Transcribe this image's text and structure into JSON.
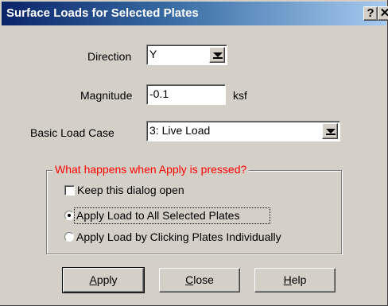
{
  "window": {
    "title": "Surface Loads for Selected Plates",
    "help_glyph": "?",
    "close_glyph": "✕"
  },
  "form": {
    "direction_label": "Direction",
    "direction_value": "Y",
    "magnitude_label": "Magnitude",
    "magnitude_value": "-0.1",
    "magnitude_unit": "ksf",
    "load_case_label": "Basic Load Case",
    "load_case_value": "3: Live Load"
  },
  "group": {
    "title": "What happens when Apply is pressed?",
    "keep_open_label": "Keep this dialog open",
    "keep_open_checked": false,
    "options": [
      {
        "label": "Apply Load to All Selected Plates",
        "selected": true
      },
      {
        "label": "Apply Load by Clicking Plates Individually",
        "selected": false
      }
    ]
  },
  "buttons": {
    "apply": {
      "mnemonic": "A",
      "rest": "pply"
    },
    "close": {
      "mnemonic": "C",
      "rest": "lose"
    },
    "help": {
      "mnemonic": "H",
      "rest": "elp"
    }
  },
  "colors": {
    "title_gradient_start": "#0a246a",
    "title_gradient_end": "#a6caf0",
    "group_title": "#ff0000",
    "dialog_face": "#d4d0c8"
  }
}
